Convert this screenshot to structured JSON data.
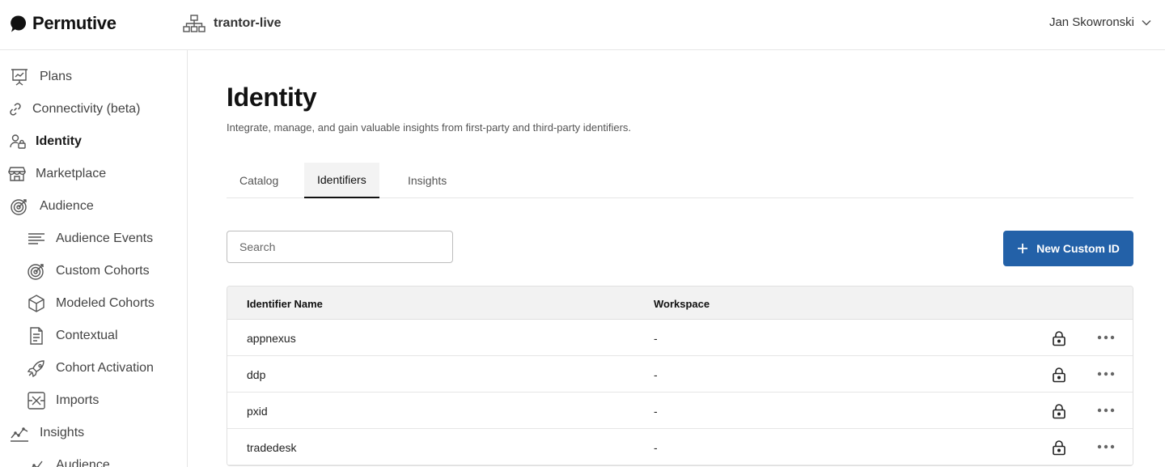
{
  "brand": {
    "name": "Permutive"
  },
  "workspace": {
    "name": "trantor-live",
    "icon": "org-chart-icon"
  },
  "user": {
    "name": "Jan Skowronski"
  },
  "sidebar": {
    "items": [
      {
        "label": "Plans",
        "icon": "presentation-board-icon"
      },
      {
        "label": "Connectivity (beta)",
        "icon": "link-icon"
      },
      {
        "label": "Identity",
        "icon": "user-lock-icon",
        "active": true
      },
      {
        "label": "Marketplace",
        "icon": "storefront-icon"
      },
      {
        "label": "Audience",
        "icon": "target-icon"
      },
      {
        "label": "Audience Events",
        "icon": "lines-icon"
      },
      {
        "label": "Custom Cohorts",
        "icon": "target-icon"
      },
      {
        "label": "Modeled Cohorts",
        "icon": "cube-icon"
      },
      {
        "label": "Contextual",
        "icon": "document-icon"
      },
      {
        "label": "Cohort Activation",
        "icon": "rocket-icon"
      },
      {
        "label": "Imports",
        "icon": "import-icon"
      },
      {
        "label": "Insights",
        "icon": "trend-chart-icon"
      },
      {
        "label": "Audience",
        "icon": "chart-icon"
      }
    ]
  },
  "page": {
    "title": "Identity",
    "subtitle": "Integrate, manage, and gain valuable insights from first-party and third-party identifiers."
  },
  "tabs": [
    {
      "label": "Catalog"
    },
    {
      "label": "Identifiers",
      "active": true
    },
    {
      "label": "Insights"
    }
  ],
  "search": {
    "placeholder": "Search",
    "value": ""
  },
  "actions": {
    "new_custom_id": "New Custom ID"
  },
  "table": {
    "columns": [
      "Identifier Name",
      "Workspace"
    ],
    "rows": [
      {
        "name": "appnexus",
        "workspace": "-"
      },
      {
        "name": "ddp",
        "workspace": "-"
      },
      {
        "name": "pxid",
        "workspace": "-"
      },
      {
        "name": "tradedesk",
        "workspace": "-"
      }
    ]
  },
  "colors": {
    "primary": "#2361a8",
    "text": "#1a1a1a",
    "border": "#e6e6e6",
    "header_bg": "#f2f2f2"
  }
}
